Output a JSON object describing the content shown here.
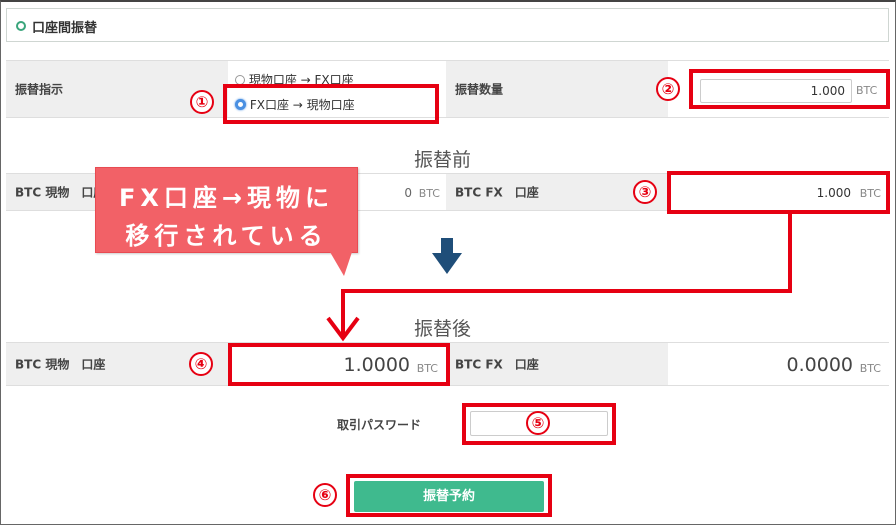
{
  "header": {
    "title": "口座間振替"
  },
  "transfer_instruction": {
    "label": "振替指示",
    "option_1": "現物口座 → FX口座",
    "option_2": "FX口座 → 現物口座",
    "selected": "FX口座 → 現物口座"
  },
  "transfer_amount": {
    "label": "振替数量",
    "value": "1.000",
    "unit": "BTC"
  },
  "before": {
    "title": "振替前",
    "spot_label": "BTC 現物　口座",
    "spot_value": "0",
    "spot_unit": "BTC",
    "fx_label": "BTC FX　口座",
    "fx_value": "1.000",
    "fx_unit": "BTC"
  },
  "after": {
    "title": "振替後",
    "spot_label": "BTC 現物　口座",
    "spot_value": "1.0000",
    "spot_unit": "BTC",
    "fx_label": "BTC FX　口座",
    "fx_value": "0.0000",
    "fx_unit": "BTC"
  },
  "password": {
    "label": "取引パスワード",
    "value": ""
  },
  "submit": {
    "label": "振替予約"
  },
  "callout": {
    "line1": "FX口座→現物に",
    "line2": "移行されている"
  },
  "markers": {
    "m1": "①",
    "m2": "②",
    "m3": "③",
    "m4": "④",
    "m5": "⑤",
    "m6": "⑥"
  },
  "colors": {
    "accent": "#3fba8e",
    "annotation": "#e60012",
    "callout": "#f26167",
    "arrow": "#1f4e79"
  }
}
